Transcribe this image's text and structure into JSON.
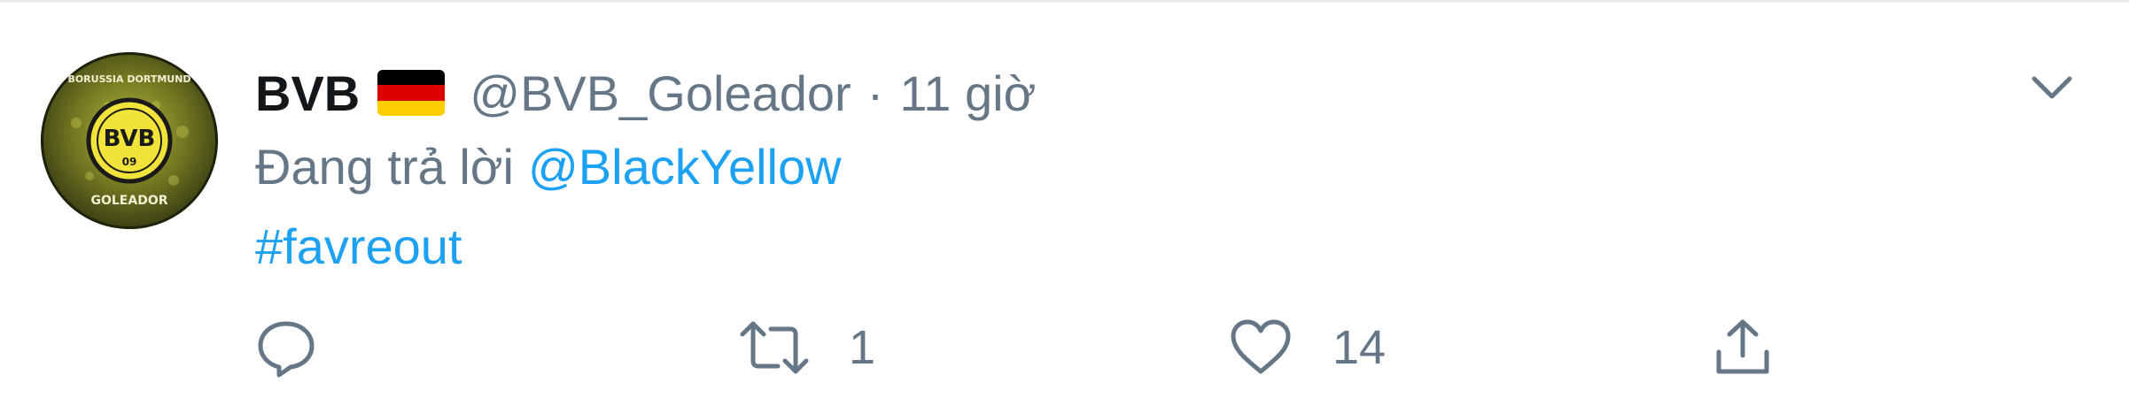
{
  "tweet": {
    "display_name": "BVB",
    "handle": "@BVB_Goleador",
    "separator": "·",
    "time": "11 giờ",
    "reply_prefix": "Đang trả lời",
    "reply_target": "@BlackYellow",
    "hashtag": "#favreout",
    "flag_colors": [
      "#000000",
      "#dd0000",
      "#ffce00"
    ]
  },
  "avatar": {
    "top_text": "BORUSSIA DORTMUND",
    "badge_text": "BVB",
    "badge_year": "09",
    "bottom_text": "GOLEADOR"
  },
  "actions": {
    "reply_icon": "reply-icon",
    "retweet_icon": "retweet-icon",
    "retweet_count": "1",
    "like_icon": "heart-icon",
    "like_count": "14",
    "share_icon": "share-icon"
  },
  "colors": {
    "link": "#1da1f2",
    "secondary_text": "#657786",
    "primary_text": "#14171a",
    "divider": "#e6ecf0"
  }
}
